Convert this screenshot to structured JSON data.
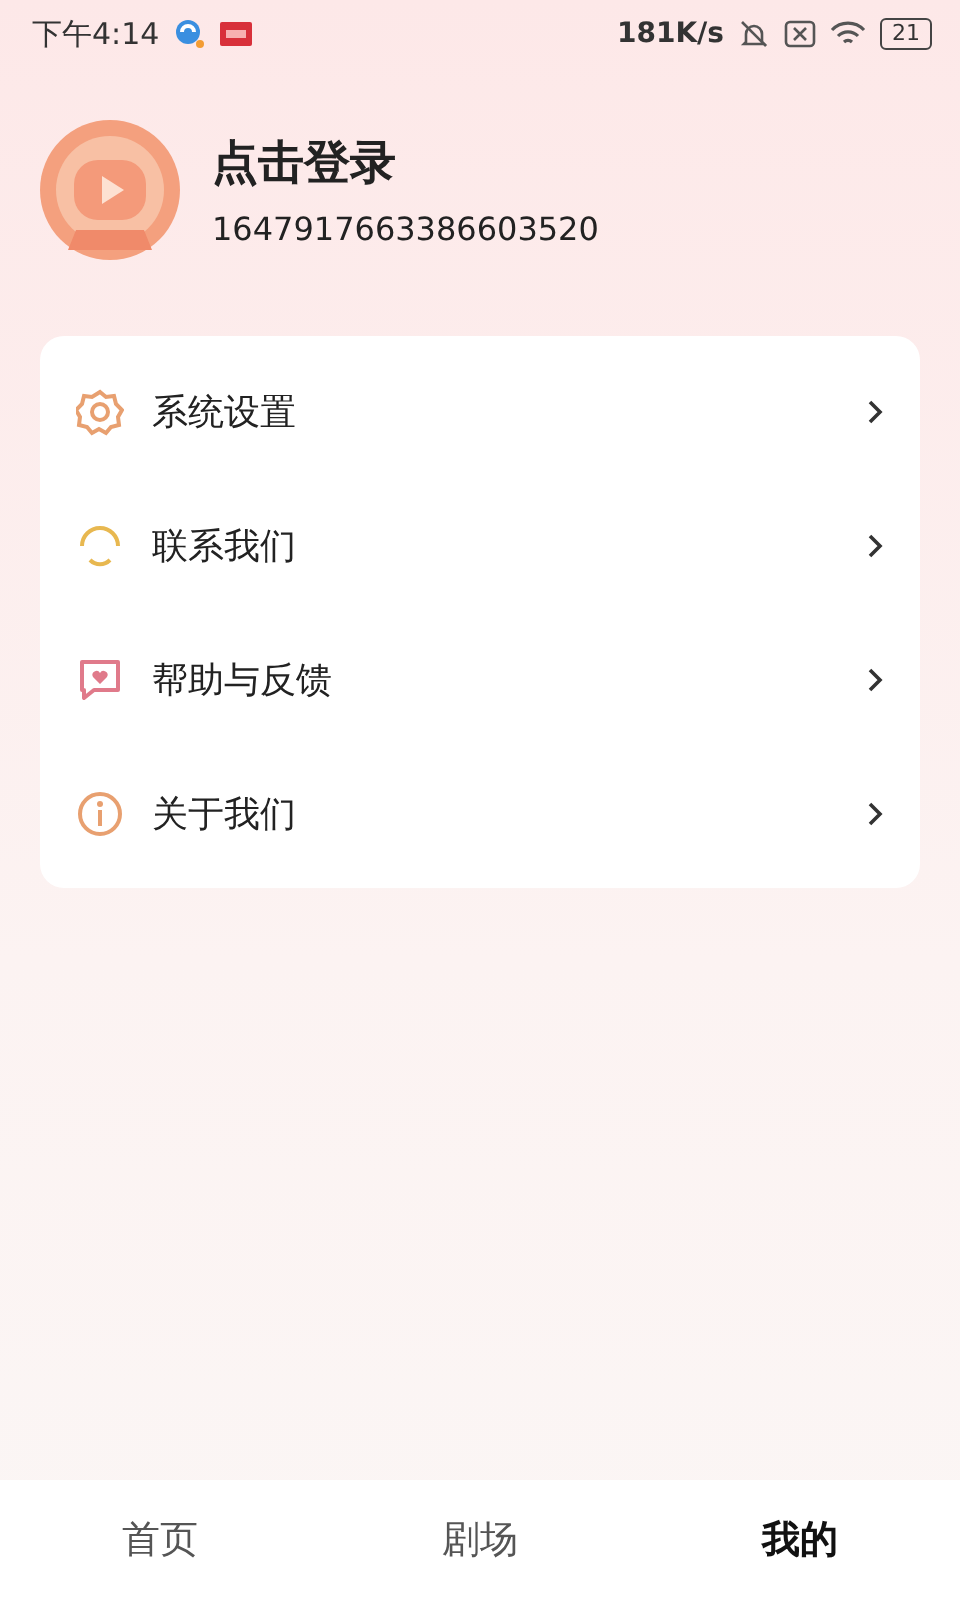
{
  "status_bar": {
    "time": "下午4:14",
    "speed": "181K/s",
    "battery": "21"
  },
  "profile": {
    "name": "点击登录",
    "id": "1647917663386603520"
  },
  "menu": [
    {
      "kind": "settings",
      "label": "系统设置",
      "color": "#e8a070"
    },
    {
      "kind": "contact",
      "label": "联系我们",
      "color": "#e8b850"
    },
    {
      "kind": "feedback",
      "label": "帮助与反馈",
      "color": "#e07a8a"
    },
    {
      "kind": "about",
      "label": "关于我们",
      "color": "#e8a070"
    }
  ],
  "tabs": [
    {
      "label": "首页",
      "selected": false
    },
    {
      "label": "剧场",
      "selected": false
    },
    {
      "label": "我的",
      "selected": true
    }
  ]
}
